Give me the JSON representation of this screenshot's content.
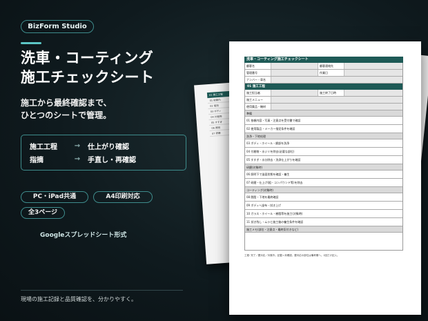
{
  "brand": "BizForm Studio",
  "title_line1": "洗車・コーティング",
  "title_line2": "施工チェックシート",
  "subtitle_line1": "施工から最終確認まで、",
  "subtitle_line2": "ひとつのシートで管理。",
  "flow": [
    {
      "label": "施工工程",
      "arrow": "→",
      "result": "仕上がり確認"
    },
    {
      "label": "指摘",
      "arrow": "→",
      "result": "手直し・再確認"
    }
  ],
  "pills": {
    "pc": "PC・iPad共通",
    "a4": "A4印刷対応",
    "pages": "全3ページ"
  },
  "format_note": "Googleスプレッドシート形式",
  "footer": "現場の施工記録と品質確認を、分かりやすく。",
  "colors": {
    "accent": "#5cc6c6",
    "sheet_header": "#1e5a56",
    "border": "#3e8c8c"
  },
  "sheet": {
    "title": "洗車・コーティング施工チェックシート",
    "info": [
      {
        "k1": "顧客名",
        "k2": "顧客連絡先"
      },
      {
        "k1": "管理番号",
        "k2": "作業日"
      }
    ],
    "plate_label": "ナンバー・車名",
    "section_title": "01 施工工程",
    "work_rows": [
      {
        "k": "施工担当者",
        "k2": "施工終了日時"
      },
      {
        "k": "施工メニュー"
      },
      {
        "k": "使用薬品・機材"
      }
    ],
    "categories": [
      {
        "name": "準備",
        "items": [
          "01 依頼内容・写真・注意点を受付書で確認",
          "02 使用製品・メーカー指定条件を確認"
        ]
      },
      {
        "name": "洗浄・下地処理",
        "items": [
          "03 ボディ・ホイール・鋼部を洗浄",
          "04 付着物・水ジミを除去(必要な部位)",
          "05 すすぎ・水分除去・洗浄仕上がりを確認"
        ]
      },
      {
        "name": "研磨(対象時)",
        "items": [
          "06 照明下で塗面状態を確認・養生",
          "07 研磨・仕上げ(粗・コンパウンド等)を除去"
        ]
      },
      {
        "name": "コーティング(対象時)",
        "items": [
          "08 脱脂・下地を最終確認",
          "09 ボディへ塗布・拭き上げ",
          "10 ガラス・ホイール・樹脂等を施工(対象時)",
          "11 拭き残し・ムラと施工後の養生条件を確認"
        ]
      }
    ],
    "memo_label": "施工メモ(部位・注意点・最終気付きなど)",
    "foot_note": "工程: 完了／要対応／対象外。記載＝未確認、要対応の部位は備考欄へ。1回だけ記入。"
  },
  "back_left": {
    "head": "01 施工工程",
    "rows": [
      "01 依頼内",
      "02 使用",
      "03 ボディ",
      "04 付着物",
      "05 すすぎ",
      "06 照明",
      "07 研磨"
    ]
  }
}
